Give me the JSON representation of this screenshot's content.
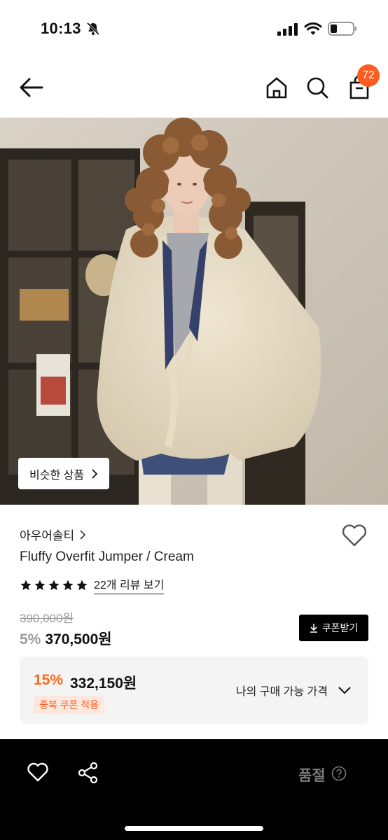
{
  "status_bar": {
    "time": "10:13",
    "battery_level": 0.3
  },
  "nav": {
    "cart_count": "72",
    "icons": [
      "back-arrow-icon",
      "home-icon",
      "search-icon",
      "shopping-bag-icon"
    ]
  },
  "image": {
    "similar_button_label": "비슷한 상품"
  },
  "product": {
    "brand": "아우어솔티",
    "name": "Fluffy Overfit Jumper / Cream",
    "rating": 5,
    "review_link": "22개 리뷰 보기",
    "original_price": "390,000원",
    "discount_rate": "5%",
    "sale_price": "370,500원",
    "coupon_button_label": "쿠폰받기"
  },
  "coupon_box": {
    "discount_rate": "15%",
    "price": "332,150원",
    "tag": "중복 쿠폰 적용",
    "link_label": "나의 구매 가능 가격"
  },
  "bottom_bar": {
    "status_label": "품절"
  },
  "colors": {
    "accent": "#ff5a1f",
    "badge": "#ff5a1f",
    "dark": "#000000"
  }
}
